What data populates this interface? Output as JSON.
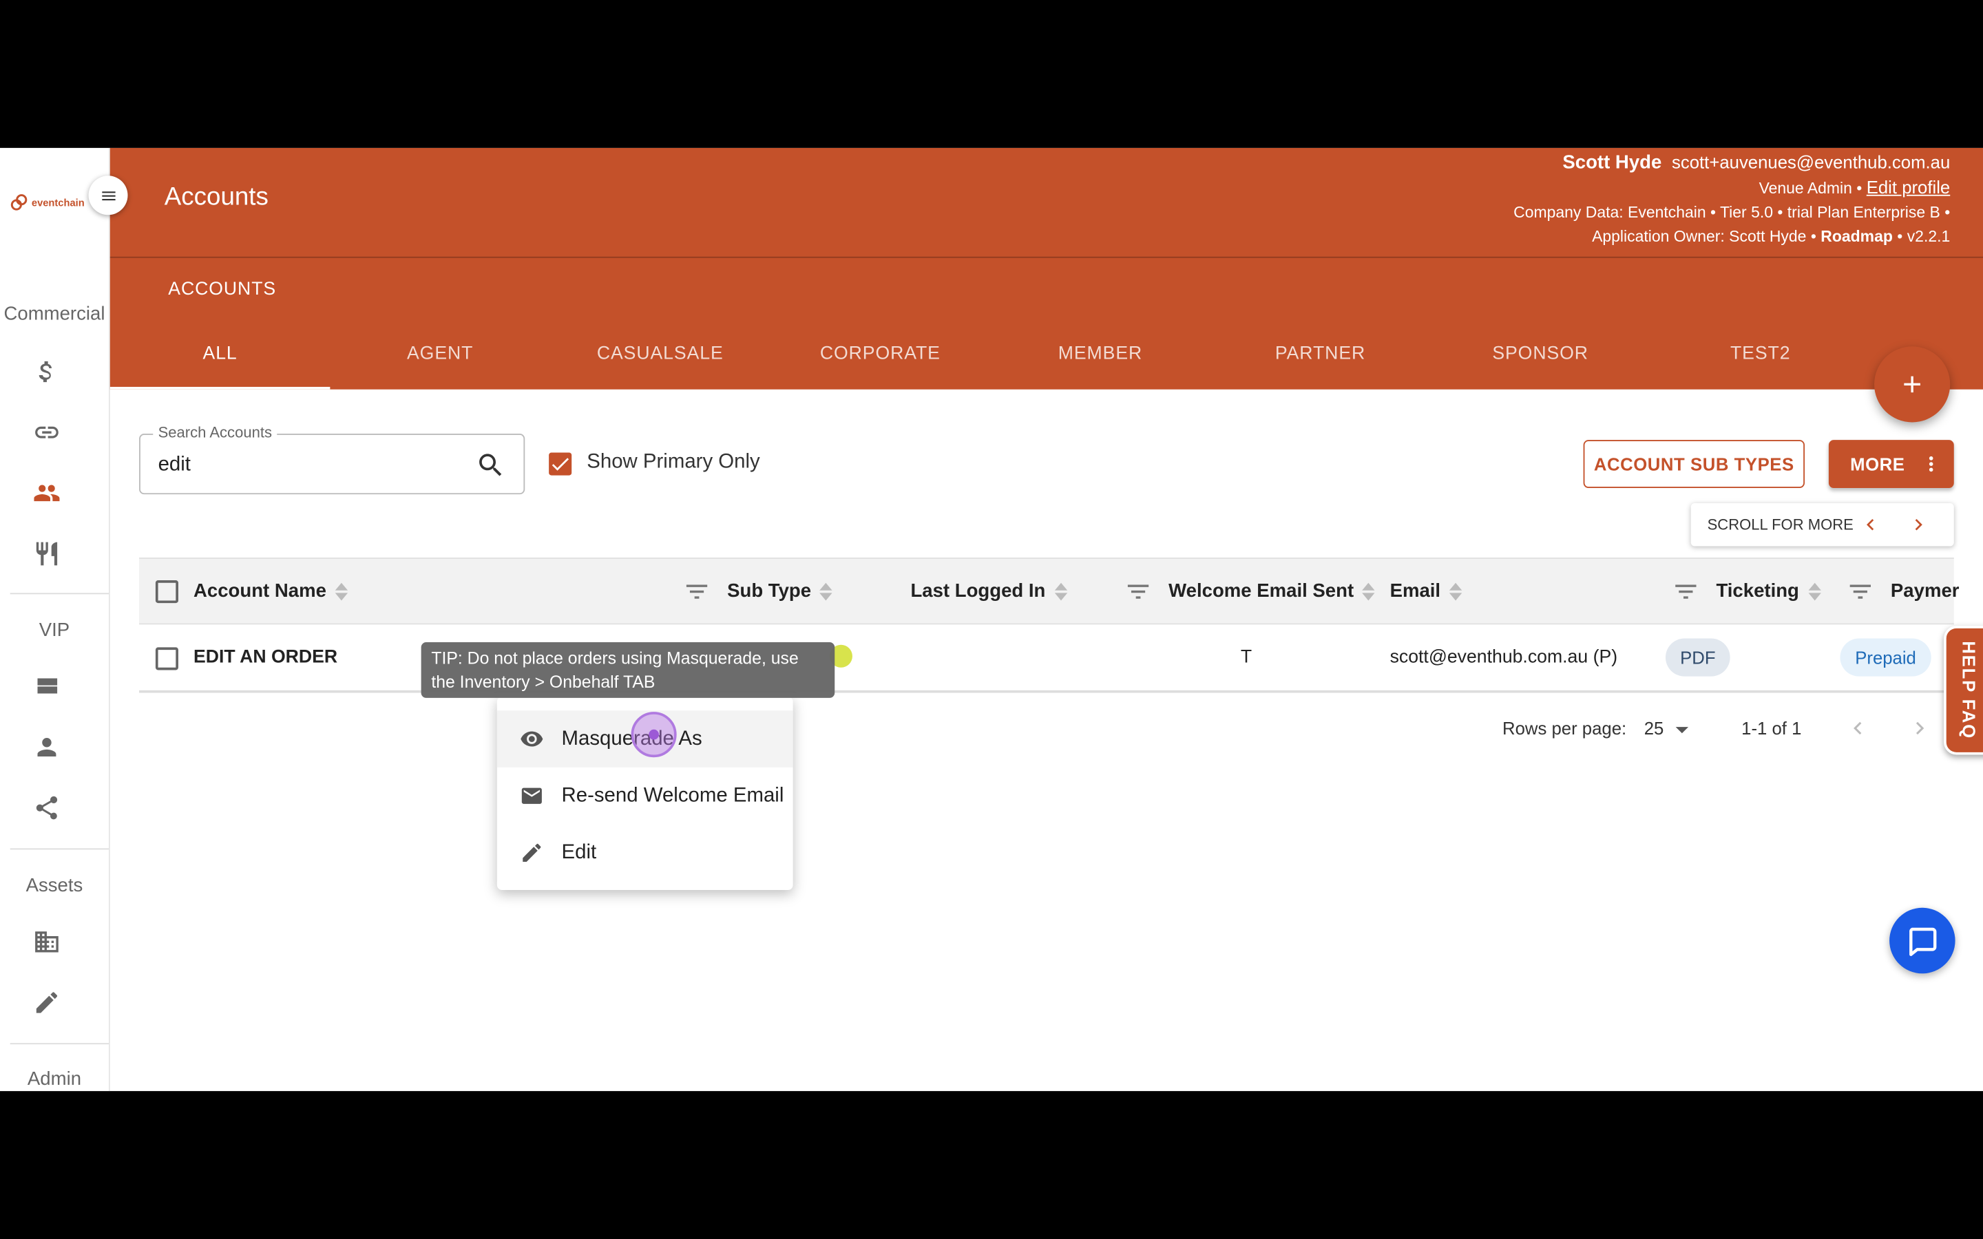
{
  "brand": {
    "logo_text": "eventchain",
    "accent": "#c4512a"
  },
  "sidebar": {
    "sections": [
      "Commercial",
      "VIP",
      "Assets",
      "Admin"
    ],
    "icons": [
      "dollar-icon",
      "link-icon",
      "people-icon",
      "restaurant-icon",
      "view-stream-icon",
      "person-icon",
      "share-icon",
      "building-icon",
      "pencil-icon"
    ]
  },
  "header": {
    "title": "Accounts",
    "subtitle": "ACCOUNTS",
    "user_name": "Scott Hyde",
    "user_email": "scott+auvenues@eventhub.com.au",
    "role": "Venue Admin •",
    "edit_profile": "Edit profile",
    "company_line": "Company Data: Eventchain • Tier 5.0 • trial Plan Enterprise B •",
    "owner_line": "Application Owner: Scott Hyde •",
    "roadmap": "Roadmap",
    "version": "• v2.2.1"
  },
  "tabs": [
    "ALL",
    "AGENT",
    "CASUALSALE",
    "CORPORATE",
    "MEMBER",
    "PARTNER",
    "SPONSOR",
    "TEST2"
  ],
  "toolbar": {
    "search_label": "Search Accounts",
    "search_value": "edit",
    "show_primary_label": "Show Primary Only",
    "sub_types_button": "ACCOUNT SUB TYPES",
    "more_button": "MORE",
    "scroll_label": "SCROLL FOR MORE"
  },
  "table": {
    "columns": [
      "Account Name",
      "Sub Type",
      "Last Logged In",
      "Welcome Email Sent",
      "Email",
      "Ticketing",
      "Paymer"
    ],
    "rows": [
      {
        "account_name": "EDIT AN ORDER",
        "welcome_email_sent": "T",
        "email": "scott@eventhub.com.au (P)",
        "ticketing": "PDF",
        "payment": "Prepaid"
      }
    ]
  },
  "pagination": {
    "rows_label": "Rows per page:",
    "rows_value": "25",
    "range": "1-1 of 1"
  },
  "tooltip": "TIP: Do not place orders using Masquerade, use the Inventory > Onbehalf TAB",
  "context_menu": [
    {
      "label": "Masquerade As",
      "icon": "eye-icon"
    },
    {
      "label": "Re-send Welcome Email",
      "icon": "mail-icon"
    },
    {
      "label": "Edit",
      "icon": "pencil-icon"
    }
  ],
  "help_faq": "HELP FAQ"
}
